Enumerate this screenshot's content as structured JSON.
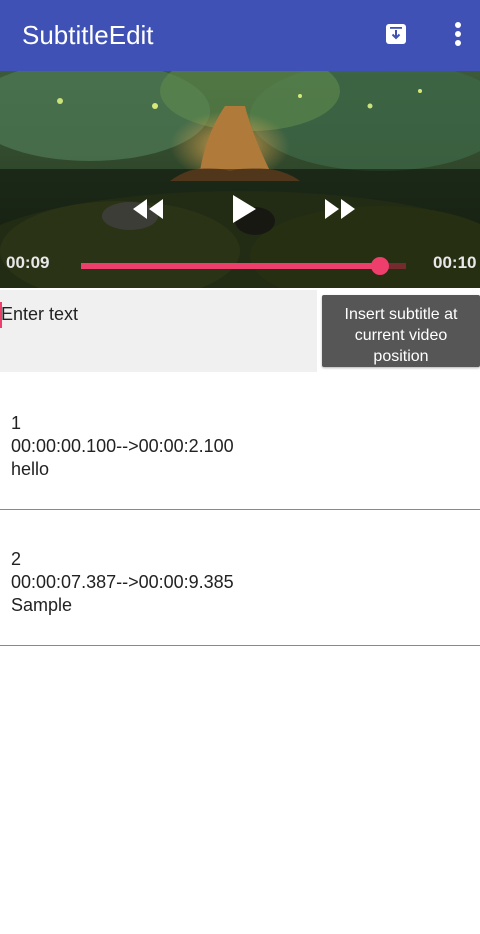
{
  "app": {
    "title": "SubtitleEdit",
    "accent_color": "#3f51b5",
    "seek_color": "#ee3e6c"
  },
  "toolbar": {
    "save_icon": "save-download-icon",
    "more_icon": "more-vert-icon"
  },
  "player": {
    "current_time": "00:09",
    "total_time": "00:10",
    "progress": 0.92,
    "rewind_icon": "rewind-icon",
    "play_icon": "play-icon",
    "ffwd_icon": "fast-forward-icon"
  },
  "editor": {
    "input_placeholder": "Enter text",
    "input_value": "",
    "insert_button_label": "Insert subtitle at current video position"
  },
  "subtitles": [
    {
      "index": "1",
      "timing": "00:00:00.100-->00:00:2.100",
      "text": "hello"
    },
    {
      "index": "2",
      "timing": "00:00:07.387-->00:00:9.385",
      "text": "Sample"
    }
  ]
}
